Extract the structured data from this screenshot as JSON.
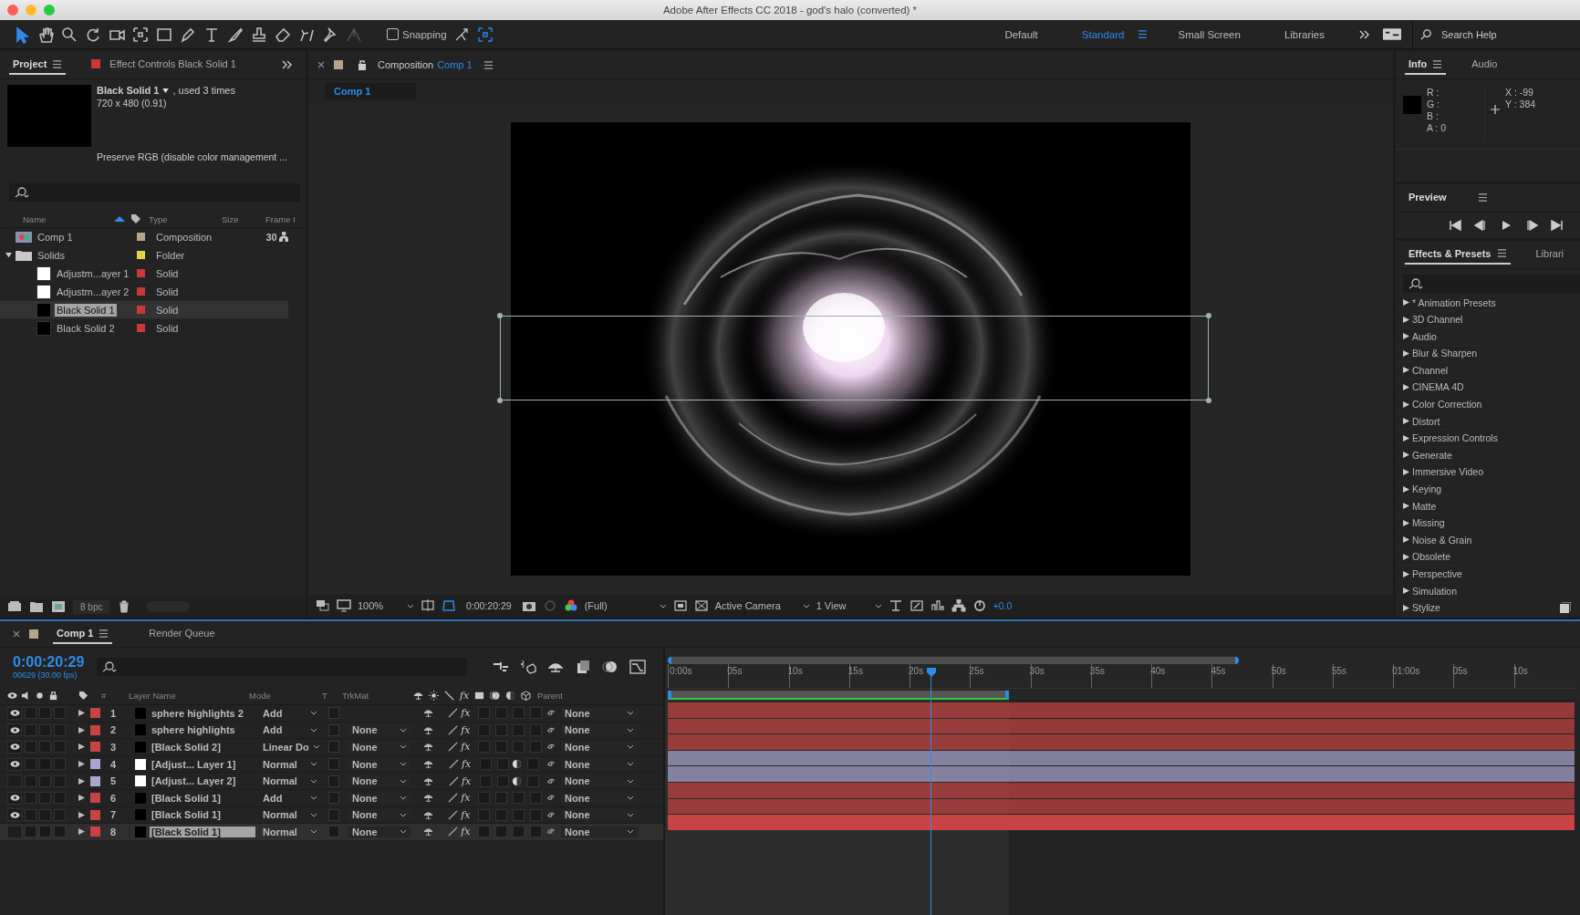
{
  "window": {
    "title": "Adobe After Effects CC 2018 - god's halo (converted) *"
  },
  "toolbar": {
    "snapping": {
      "label": "Snapping",
      "checked": false
    }
  },
  "workspaces": [
    {
      "label": "Default",
      "selected": false
    },
    {
      "label": "Standard",
      "selected": true
    },
    {
      "label": "Small Screen",
      "selected": false
    },
    {
      "label": "Libraries",
      "selected": false
    }
  ],
  "search_help": {
    "placeholder": "Search Help"
  },
  "project_panel": {
    "tabs": [
      {
        "label": "Project",
        "selected": true
      },
      {
        "label": "Effect Controls Black Solid 1",
        "selected": false
      }
    ],
    "item_name": "Black Solid 1",
    "usage": ", used 3 times",
    "dimensions": "720 x 480 (0.91)",
    "color_note": "Preserve RGB (disable color management ...",
    "columns": [
      "Name",
      "Type",
      "Size",
      "Frame I"
    ],
    "items": [
      {
        "name": "Comp 1",
        "kind": "composition",
        "color": "#b5a588",
        "type": "Composition",
        "frame_rate": "30",
        "selected": false
      },
      {
        "name": "Solids",
        "kind": "folder",
        "color": "#e3d445",
        "type": "Folder",
        "expanded": true,
        "selected": false,
        "children": [
          {
            "name": "Adjustm...ayer 1",
            "kind": "white-solid",
            "color": "#c83a3a",
            "type": "Solid",
            "selected": false
          },
          {
            "name": "Adjustm...ayer 2",
            "kind": "white-solid",
            "color": "#c83a3a",
            "type": "Solid",
            "selected": false
          },
          {
            "name": "Black Solid 1",
            "kind": "black-solid",
            "color": "#c83a3a",
            "type": "Solid",
            "selected": true
          },
          {
            "name": "Black Solid 2",
            "kind": "black-solid",
            "color": "#c83a3a",
            "type": "Solid",
            "selected": false
          }
        ]
      }
    ],
    "bit_depth": "8 bpc"
  },
  "composition_panel": {
    "tab_label": "Composition",
    "comp_name": "Comp 1",
    "breadcrumb": "Comp 1",
    "zoom": "100%",
    "timecode": "0:00:20:29",
    "resolution": "(Full)",
    "camera": "Active Camera",
    "views": "1 View",
    "exposure": "+0.0"
  },
  "info_panel": {
    "tabs": [
      {
        "label": "Info",
        "selected": true
      },
      {
        "label": "Audio",
        "selected": false
      }
    ],
    "channels": [
      "R :",
      "G :",
      "B :",
      "A : 0"
    ],
    "x": "X : -99",
    "y": "Y : 384"
  },
  "preview_panel": {
    "title": "Preview"
  },
  "effects_panel": {
    "tabs": [
      {
        "label": "Effects & Presets",
        "selected": true
      },
      {
        "label": "Librari",
        "selected": false
      }
    ],
    "categories": [
      "* Animation Presets",
      "3D Channel",
      "Audio",
      "Blur & Sharpen",
      "Channel",
      "CINEMA 4D",
      "Color Correction",
      "Distort",
      "Expression Controls",
      "Generate",
      "Immersive Video",
      "Keying",
      "Matte",
      "Missing",
      "Noise & Grain",
      "Obsolete",
      "Perspective",
      "Simulation",
      "Stylize"
    ]
  },
  "timeline": {
    "tabs": [
      {
        "label": "Comp 1",
        "selected": true
      },
      {
        "label": "Render Queue",
        "selected": false
      }
    ],
    "timecode": "0:00:20:29",
    "frame_info": "00629 (30.00 fps)",
    "columns": {
      "number": "#",
      "layer_name": "Layer Name",
      "mode": "Mode",
      "t": "T",
      "trkmat": "TrkMat",
      "fx": "fx",
      "parent": "Parent"
    },
    "layers": [
      {
        "number": "1",
        "name": "sphere highlights 2",
        "visible": true,
        "adjustment": false,
        "color": "#c84343",
        "mode": "Add",
        "fx": "fx",
        "parent": "None",
        "selected": false
      },
      {
        "number": "2",
        "name": "sphere highlights",
        "visible": true,
        "adjustment": false,
        "color": "#c84343",
        "mode": "Add",
        "trkmat": "None",
        "fx": "fx",
        "parent": "None",
        "selected": false
      },
      {
        "number": "3",
        "name": "[Black Solid 2]",
        "visible": true,
        "adjustment": false,
        "color": "#c84343",
        "mode": "Linear Do",
        "trkmat": "None",
        "fx": "fx",
        "parent": "None",
        "selected": false
      },
      {
        "number": "4",
        "name": "[Adjust... Layer 1]",
        "visible": true,
        "adjustment": true,
        "color": "#a9a7cf",
        "mode": "Normal",
        "trkmat": "None",
        "fx": "fx",
        "parent": "None",
        "selected": false
      },
      {
        "number": "5",
        "name": "[Adjust... Layer 2]",
        "visible": false,
        "adjustment": true,
        "color": "#a9a7cf",
        "mode": "Normal",
        "trkmat": "None",
        "fx": "fx",
        "parent": "None",
        "selected": false
      },
      {
        "number": "6",
        "name": "[Black Solid 1]",
        "visible": true,
        "adjustment": false,
        "color": "#c84343",
        "mode": "Add",
        "trkmat": "None",
        "fx": "fx",
        "parent": "None",
        "selected": false
      },
      {
        "number": "7",
        "name": "[Black Solid 1]",
        "visible": true,
        "adjustment": false,
        "color": "#c84343",
        "mode": "Normal",
        "trkmat": "None",
        "fx": "fx",
        "parent": "None",
        "selected": false
      },
      {
        "number": "8",
        "name": "[Black Solid 1]",
        "visible": false,
        "adjustment": false,
        "color": "#c84343",
        "mode": "Normal",
        "trkmat": "None",
        "fx": "fx",
        "parent": "None",
        "selected": true
      }
    ],
    "ruler": [
      "0:00s",
      "05s",
      "10s",
      "15s",
      "20s",
      "25s",
      "30s",
      "35s",
      "40s",
      "45s",
      "50s",
      "55s",
      "01:00s",
      "05s",
      "10s"
    ],
    "navigator": {
      "level": 0.63
    },
    "work_area": {
      "level": 0.376
    },
    "playhead": {
      "level": 0.288
    }
  }
}
